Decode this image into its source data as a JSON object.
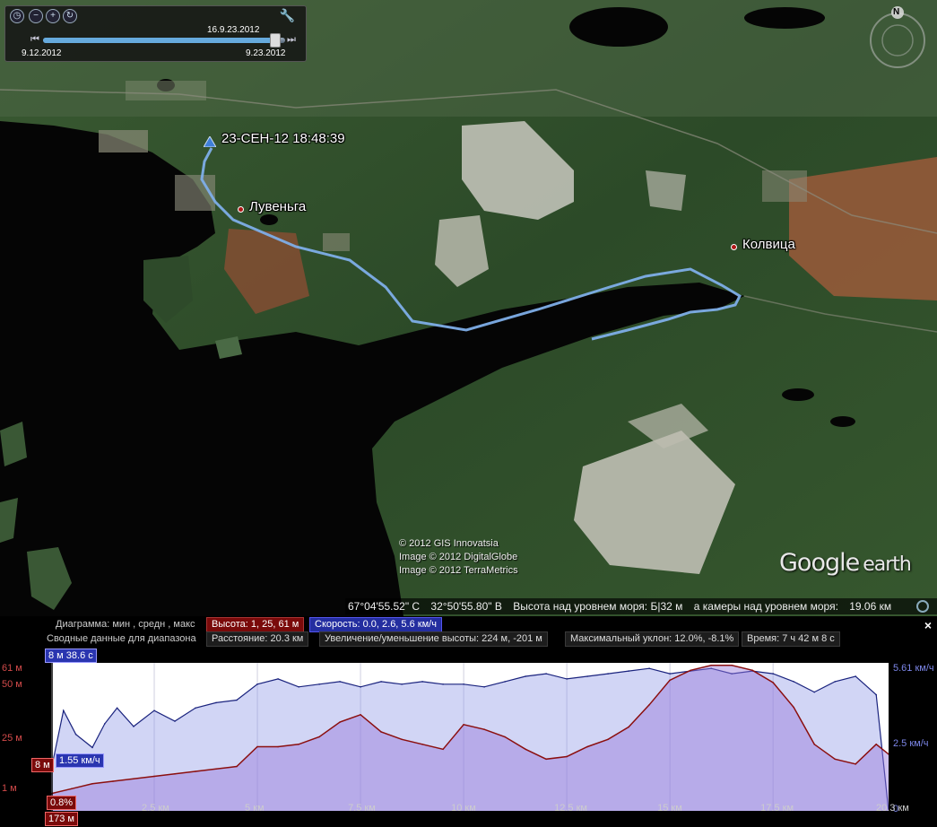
{
  "map": {
    "track_point_label": "23-СЕН-12 18:48:39",
    "places": [
      {
        "name": "Лувеньга"
      },
      {
        "name": "Колвица"
      }
    ],
    "copyright": [
      "© 2012 GIS Innovatsia",
      "Image © 2012 DigitalGlobe",
      "Image © 2012 TerraMetrics"
    ],
    "brand": {
      "name": "Google",
      "product": "earth"
    },
    "status": {
      "lat": "67°04'55.52\" С",
      "lon": "32°50'55.80\" В",
      "elevation_text": "Высота над уровнем моря: Б|32 м",
      "eye_text": "а камеры над уровнем моря:",
      "eye_value": "19.06 км"
    },
    "compass_label": "N",
    "colors": {
      "track": "#7eaee8",
      "water": "#040404",
      "forest": "#2f4d2a"
    }
  },
  "time_slider": {
    "start_label": "9.12.2012",
    "end_label": "9.23.2012",
    "current_label": "16.9.23.2012",
    "progress": 0.96,
    "icons": [
      "clock-icon",
      "zoom-out-icon",
      "zoom-in-icon",
      "refresh-icon",
      "wrench-icon"
    ]
  },
  "panel": {
    "row1": {
      "label": "Диаграмма: мин , средн , макс",
      "elevation": "Высота: 1, 25, 61 м",
      "speed": "Скорость: 0.0, 2.6, 5.6 км/ч"
    },
    "row2": {
      "label": "Сводные данные для диапазона",
      "distance": "Расстояние: 20.3 км",
      "gain_loss": "Увеличение/уменьшение высоты: 224 м, -201 м",
      "slope": "Максимальный уклон: 12.0%, -8.1%",
      "time": "Время: 7 ч 42 м 8 с"
    },
    "close_label": "×",
    "cursor": {
      "elapsed": "8 м 38.6 с",
      "elevation": "8 м",
      "speed": "1.55 км/ч",
      "slope": "0.8%",
      "distance": "173 м"
    },
    "left_ticks": [
      "61 м",
      "50 м",
      "25 м",
      "1 м"
    ],
    "right_ticks": [
      "5.61 км/ч",
      "2.5 км/ч",
      "0"
    ],
    "x_ticks": [
      "2.5 км",
      "5 км",
      "7.5 км",
      "10 км",
      "12.5 км",
      "15 км",
      "17.5 км",
      "20.3 км"
    ]
  },
  "chart_data": {
    "type": "area",
    "xlabel": "",
    "ylabel": "",
    "x_unit": "km",
    "xlim": [
      0,
      20.3
    ],
    "series": [
      {
        "axis": "left",
        "unit": "m",
        "color": "#8b0f0f",
        "ylim": [
          1,
          61
        ],
        "x": [
          0,
          0.5,
          1,
          1.5,
          2,
          2.5,
          3,
          3.5,
          4,
          4.5,
          5,
          5.5,
          6,
          6.5,
          7,
          7.5,
          8,
          8.5,
          9,
          9.5,
          10,
          10.5,
          11,
          11.5,
          12,
          12.5,
          13,
          13.5,
          14,
          14.5,
          15,
          15.5,
          16,
          16.5,
          17,
          17.5,
          18,
          18.5,
          19,
          19.5,
          20,
          20.3
        ],
        "values": [
          8,
          10,
          12,
          13,
          14,
          15,
          16,
          17,
          18,
          19,
          27,
          27,
          28,
          31,
          37,
          40,
          33,
          30,
          28,
          26,
          36,
          34,
          31,
          26,
          22,
          23,
          27,
          30,
          35,
          44,
          54,
          58,
          60,
          60,
          58,
          53,
          43,
          28,
          22,
          20,
          28,
          24
        ]
      },
      {
        "axis": "right",
        "unit": "km/h",
        "color": "#1a237e",
        "ylim": [
          0,
          5.61
        ],
        "x": [
          0,
          0.3,
          0.6,
          1,
          1.3,
          1.6,
          2,
          2.5,
          3,
          3.5,
          4,
          4.5,
          5,
          5.5,
          6,
          6.5,
          7,
          7.5,
          8,
          8.5,
          9,
          9.5,
          10,
          10.5,
          11,
          11.5,
          12,
          12.5,
          13,
          13.5,
          14,
          14.5,
          15,
          15.5,
          16,
          16.5,
          17,
          17.5,
          18,
          18.5,
          19,
          19.5,
          20,
          20.3
        ],
        "values": [
          1.55,
          3.8,
          2.9,
          2.4,
          3.3,
          3.9,
          3.2,
          3.8,
          3.4,
          3.9,
          4.1,
          4.2,
          4.8,
          5.0,
          4.7,
          4.8,
          4.9,
          4.7,
          4.9,
          4.8,
          4.9,
          4.8,
          4.8,
          4.7,
          4.9,
          5.1,
          5.2,
          5.0,
          5.1,
          5.2,
          5.3,
          5.4,
          5.2,
          5.3,
          5.4,
          5.2,
          5.3,
          5.2,
          4.9,
          4.5,
          4.9,
          5.1,
          4.4,
          0
        ]
      }
    ],
    "grid": true,
    "legend": "none"
  }
}
